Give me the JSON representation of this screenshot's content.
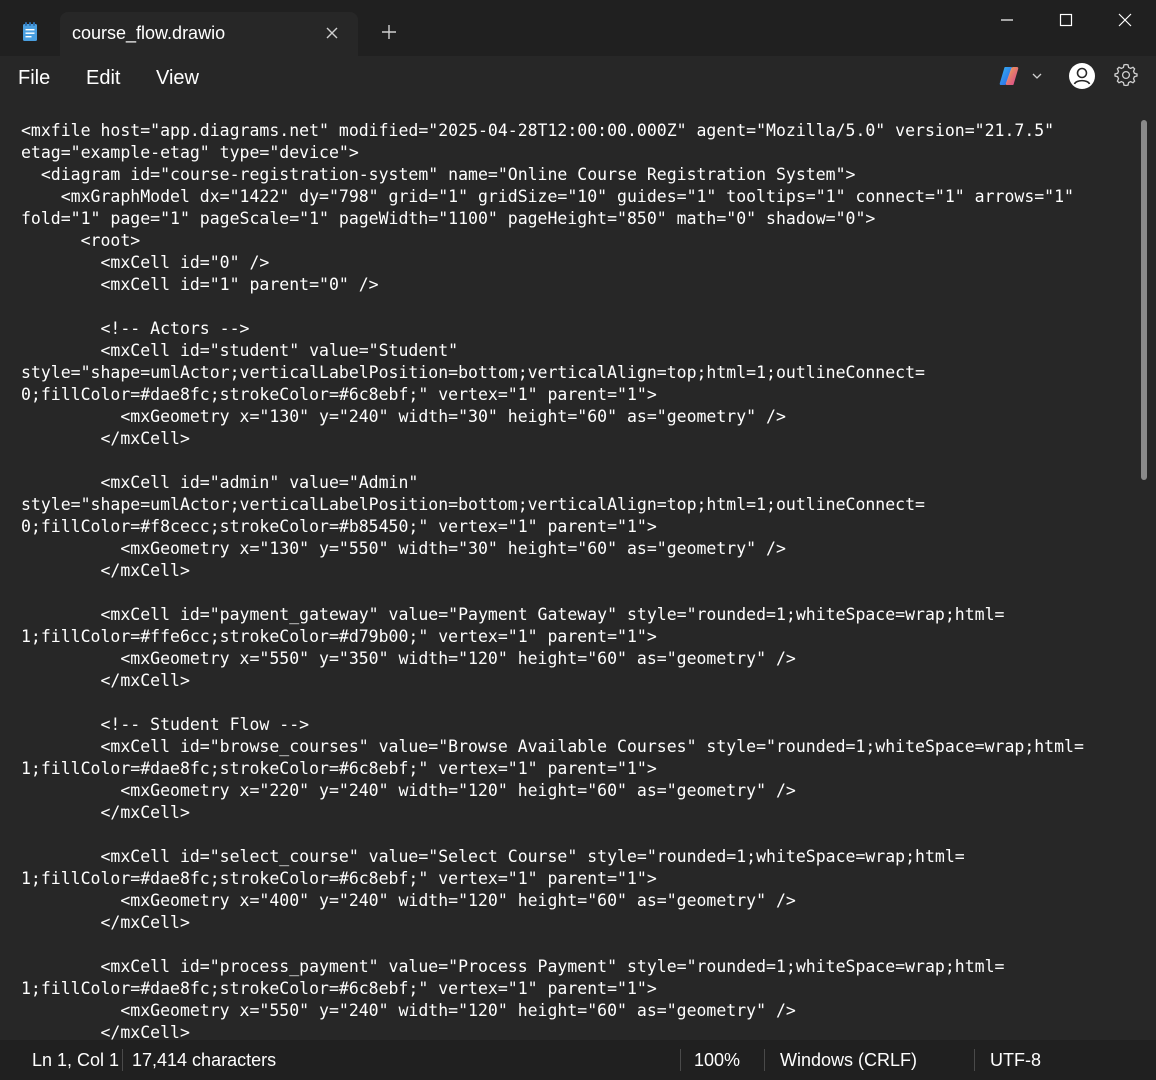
{
  "titlebar": {
    "tab_title": "course_flow.drawio",
    "icons": {
      "app": "notepad-icon",
      "close_tab": "close-icon",
      "new_tab": "plus-icon",
      "minimize": "minimize-icon",
      "maximize": "maximize-icon",
      "close_window": "close-icon"
    }
  },
  "menu": {
    "file": "File",
    "edit": "Edit",
    "view": "View",
    "icons": [
      "copilot-icon",
      "chevron-down-icon",
      "profile-icon",
      "gear-icon"
    ]
  },
  "editor": {
    "lines": [
      "<mxfile host=\"app.diagrams.net\" modified=\"2025-04-28T12:00:00.000Z\" agent=\"Mozilla/5.0\" version=\"21.7.5\"",
      "etag=\"example-etag\" type=\"device\">",
      "  <diagram id=\"course-registration-system\" name=\"Online Course Registration System\">",
      "    <mxGraphModel dx=\"1422\" dy=\"798\" grid=\"1\" gridSize=\"10\" guides=\"1\" tooltips=\"1\" connect=\"1\" arrows=\"1\"",
      "fold=\"1\" page=\"1\" pageScale=\"1\" pageWidth=\"1100\" pageHeight=\"850\" math=\"0\" shadow=\"0\">",
      "      <root>",
      "        <mxCell id=\"0\" />",
      "        <mxCell id=\"1\" parent=\"0\" />",
      "",
      "        <!-- Actors -->",
      "        <mxCell id=\"student\" value=\"Student\"",
      "style=\"shape=umlActor;verticalLabelPosition=bottom;verticalAlign=top;html=1;outlineConnect=",
      "0;fillColor=#dae8fc;strokeColor=#6c8ebf;\" vertex=\"1\" parent=\"1\">",
      "          <mxGeometry x=\"130\" y=\"240\" width=\"30\" height=\"60\" as=\"geometry\" />",
      "        </mxCell>",
      "",
      "        <mxCell id=\"admin\" value=\"Admin\"",
      "style=\"shape=umlActor;verticalLabelPosition=bottom;verticalAlign=top;html=1;outlineConnect=",
      "0;fillColor=#f8cecc;strokeColor=#b85450;\" vertex=\"1\" parent=\"1\">",
      "          <mxGeometry x=\"130\" y=\"550\" width=\"30\" height=\"60\" as=\"geometry\" />",
      "        </mxCell>",
      "",
      "        <mxCell id=\"payment_gateway\" value=\"Payment Gateway\" style=\"rounded=1;whiteSpace=wrap;html=",
      "1;fillColor=#ffe6cc;strokeColor=#d79b00;\" vertex=\"1\" parent=\"1\">",
      "          <mxGeometry x=\"550\" y=\"350\" width=\"120\" height=\"60\" as=\"geometry\" />",
      "        </mxCell>",
      "",
      "        <!-- Student Flow -->",
      "        <mxCell id=\"browse_courses\" value=\"Browse Available Courses\" style=\"rounded=1;whiteSpace=wrap;html=",
      "1;fillColor=#dae8fc;strokeColor=#6c8ebf;\" vertex=\"1\" parent=\"1\">",
      "          <mxGeometry x=\"220\" y=\"240\" width=\"120\" height=\"60\" as=\"geometry\" />",
      "        </mxCell>",
      "",
      "        <mxCell id=\"select_course\" value=\"Select Course\" style=\"rounded=1;whiteSpace=wrap;html=",
      "1;fillColor=#dae8fc;strokeColor=#6c8ebf;\" vertex=\"1\" parent=\"1\">",
      "          <mxGeometry x=\"400\" y=\"240\" width=\"120\" height=\"60\" as=\"geometry\" />",
      "        </mxCell>",
      "",
      "        <mxCell id=\"process_payment\" value=\"Process Payment\" style=\"rounded=1;whiteSpace=wrap;html=",
      "1;fillColor=#dae8fc;strokeColor=#6c8ebf;\" vertex=\"1\" parent=\"1\">",
      "          <mxGeometry x=\"550\" y=\"240\" width=\"120\" height=\"60\" as=\"geometry\" />",
      "        </mxCell>"
    ]
  },
  "status": {
    "position": "Ln 1, Col 1",
    "characters": "17,414 characters",
    "zoom": "100%",
    "line_ending": "Windows (CRLF)",
    "encoding": "UTF-8"
  }
}
